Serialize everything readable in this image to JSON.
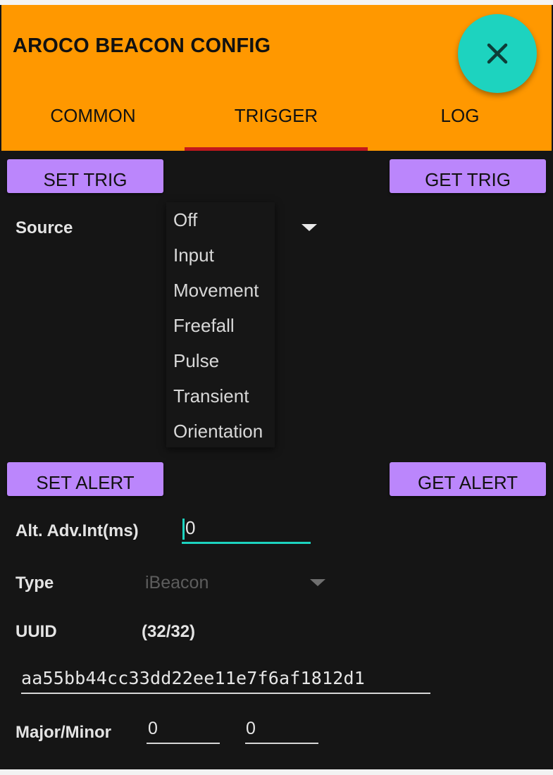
{
  "app": {
    "title": "AROCO BEACON CONFIG"
  },
  "fab": {
    "icon": "close-icon",
    "color": "#1dd3bf"
  },
  "tabs": [
    {
      "label": "COMMON",
      "selected": false
    },
    {
      "label": "TRIGGER",
      "selected": true
    },
    {
      "label": "LOG",
      "selected": false
    }
  ],
  "trigger": {
    "set_label": "SET TRIG",
    "get_label": "GET TRIG",
    "source_label": "Source",
    "source_options": [
      "Off",
      "Input",
      "Movement",
      "Freefall",
      "Pulse",
      "Transient",
      "Orientation"
    ]
  },
  "alert": {
    "set_label": "SET ALERT",
    "get_label": "GET ALERT",
    "adv_int_label": "Alt. Adv.Int(ms)",
    "adv_int_value": "0",
    "type_label": "Type",
    "type_value": "iBeacon",
    "uuid_label": "UUID",
    "uuid_count": "(32/32)",
    "uuid_value": "aa55bb44cc33dd22ee11e7f6af1812d1",
    "major_minor_label": "Major/Minor",
    "major_value": "0",
    "minor_value": "0"
  },
  "colors": {
    "appbar": "#ff9800",
    "accent": "#1dd3bf",
    "button": "#bb86fc",
    "tab_indicator": "#c2181c",
    "background": "#151515"
  }
}
